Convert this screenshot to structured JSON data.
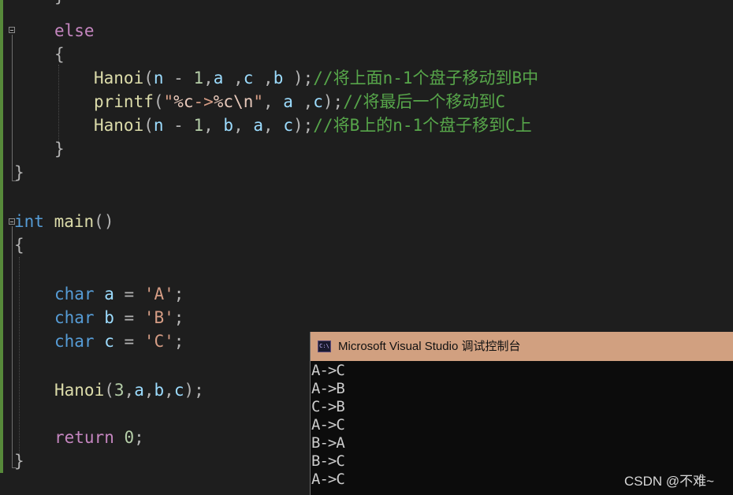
{
  "editor": {
    "lines": [
      [
        {
          "t": "}",
          "c": "punc"
        }
      ],
      [
        {
          "t": "else",
          "c": "kw"
        }
      ],
      [
        {
          "t": "{",
          "c": "punc"
        }
      ],
      [
        {
          "t": "Hanoi",
          "c": "fn"
        },
        {
          "t": "(",
          "c": "punc"
        },
        {
          "t": "n",
          "c": "var"
        },
        {
          "t": " - ",
          "c": "punc"
        },
        {
          "t": "1",
          "c": "num"
        },
        {
          "t": ",",
          "c": "punc"
        },
        {
          "t": "a",
          "c": "var"
        },
        {
          "t": " ,",
          "c": "punc"
        },
        {
          "t": "c",
          "c": "var"
        },
        {
          "t": " ,",
          "c": "punc"
        },
        {
          "t": "b",
          "c": "var"
        },
        {
          "t": " );",
          "c": "punc"
        },
        {
          "t": "//将上面n-1个盘子移动到B中",
          "c": "cmt"
        }
      ],
      [
        {
          "t": "printf",
          "c": "fn"
        },
        {
          "t": "(",
          "c": "punc"
        },
        {
          "t": "\"",
          "c": "str"
        },
        {
          "t": "%c",
          "c": "esc"
        },
        {
          "t": "->",
          "c": "str"
        },
        {
          "t": "%c\\n",
          "c": "esc"
        },
        {
          "t": "\"",
          "c": "str"
        },
        {
          "t": ", ",
          "c": "punc"
        },
        {
          "t": "a",
          "c": "var"
        },
        {
          "t": " ,",
          "c": "punc"
        },
        {
          "t": "c",
          "c": "var"
        },
        {
          "t": ");",
          "c": "punc"
        },
        {
          "t": "//将最后一个移动到C",
          "c": "cmt"
        }
      ],
      [
        {
          "t": "Hanoi",
          "c": "fn"
        },
        {
          "t": "(",
          "c": "punc"
        },
        {
          "t": "n",
          "c": "var"
        },
        {
          "t": " - ",
          "c": "punc"
        },
        {
          "t": "1",
          "c": "num"
        },
        {
          "t": ", ",
          "c": "punc"
        },
        {
          "t": "b",
          "c": "var"
        },
        {
          "t": ", ",
          "c": "punc"
        },
        {
          "t": "a",
          "c": "var"
        },
        {
          "t": ", ",
          "c": "punc"
        },
        {
          "t": "c",
          "c": "var"
        },
        {
          "t": ");",
          "c": "punc"
        },
        {
          "t": "//将B上的n-1个盘子移到C上",
          "c": "cmt"
        }
      ],
      [
        {
          "t": "}",
          "c": "punc"
        }
      ],
      [
        {
          "t": "}",
          "c": "punc"
        }
      ],
      [],
      [
        {
          "t": "int",
          "c": "type"
        },
        {
          "t": " ",
          "c": "punc"
        },
        {
          "t": "main",
          "c": "fn"
        },
        {
          "t": "()",
          "c": "punc"
        }
      ],
      [
        {
          "t": "{",
          "c": "punc"
        }
      ],
      [],
      [
        {
          "t": "char",
          "c": "type"
        },
        {
          "t": " ",
          "c": "punc"
        },
        {
          "t": "a",
          "c": "var"
        },
        {
          "t": " = ",
          "c": "punc"
        },
        {
          "t": "'A'",
          "c": "str"
        },
        {
          "t": ";",
          "c": "punc"
        }
      ],
      [
        {
          "t": "char",
          "c": "type"
        },
        {
          "t": " ",
          "c": "punc"
        },
        {
          "t": "b",
          "c": "var"
        },
        {
          "t": " = ",
          "c": "punc"
        },
        {
          "t": "'B'",
          "c": "str"
        },
        {
          "t": ";",
          "c": "punc"
        }
      ],
      [
        {
          "t": "char",
          "c": "type"
        },
        {
          "t": " ",
          "c": "punc"
        },
        {
          "t": "c",
          "c": "var"
        },
        {
          "t": " = ",
          "c": "punc"
        },
        {
          "t": "'C'",
          "c": "str"
        },
        {
          "t": ";",
          "c": "punc"
        }
      ],
      [],
      [
        {
          "t": "Hanoi",
          "c": "fn"
        },
        {
          "t": "(",
          "c": "punc"
        },
        {
          "t": "3",
          "c": "num"
        },
        {
          "t": ",",
          "c": "punc"
        },
        {
          "t": "a",
          "c": "var"
        },
        {
          "t": ",",
          "c": "punc"
        },
        {
          "t": "b",
          "c": "var"
        },
        {
          "t": ",",
          "c": "punc"
        },
        {
          "t": "c",
          "c": "var"
        },
        {
          "t": ");",
          "c": "punc"
        }
      ],
      [],
      [
        {
          "t": "return",
          "c": "kw"
        },
        {
          "t": " ",
          "c": "punc"
        },
        {
          "t": "0",
          "c": "num"
        },
        {
          "t": ";",
          "c": "punc"
        }
      ],
      [
        {
          "t": "}",
          "c": "punc"
        }
      ]
    ]
  },
  "console": {
    "title": "Microsoft Visual Studio 调试控制台",
    "icon_label": "C:\\",
    "icon_name": "console-app-icon",
    "output": [
      "A->C",
      "A->B",
      "C->B",
      "A->C",
      "B->A",
      "B->C",
      "A->C"
    ]
  },
  "watermark": "CSDN @不难~",
  "colors": {
    "editor_background": "#1e1e1e",
    "keyword": "#c586c0",
    "type": "#569cd6",
    "function": "#dcdcaa",
    "variable": "#9cdcfe",
    "number": "#b5cea8",
    "string": "#d69d85",
    "comment": "#57a64a",
    "console_titlebar": "#d1a080",
    "console_background": "#0c0c0c",
    "change_bar": "#578a3a"
  }
}
